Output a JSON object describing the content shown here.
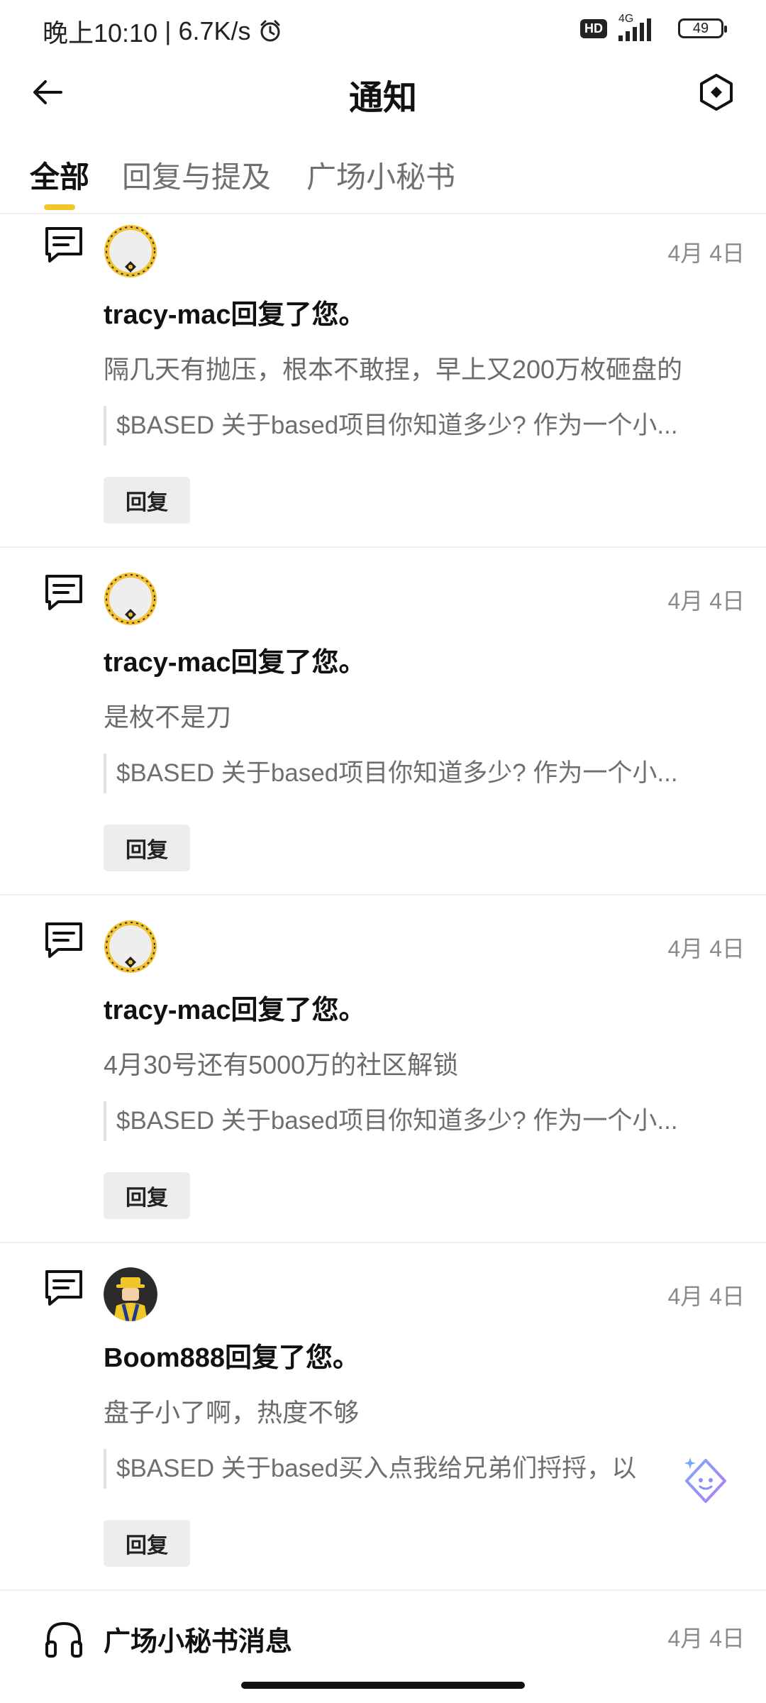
{
  "status": {
    "time": "晚上10:10",
    "speed": "6.7K/s",
    "hd": "HD",
    "network": "4G",
    "battery": "49"
  },
  "header": {
    "title": "通知"
  },
  "tabs": [
    {
      "label": "全部",
      "active": true
    },
    {
      "label": "回复与提及",
      "active": false
    },
    {
      "label": "广场小秘书",
      "active": false
    }
  ],
  "notifications": [
    {
      "date": "4月 4日",
      "title": "tracy-mac回复了您。",
      "body": "隔几天有抛压，根本不敢捏，早上又200万枚砸盘的",
      "quote": "$BASED 关于based项目你知道多少? 作为一个小...",
      "reply_label": "回复"
    },
    {
      "date": "4月 4日",
      "title": "tracy-mac回复了您。",
      "body": "是枚不是刀",
      "quote": "$BASED 关于based项目你知道多少? 作为一个小...",
      "reply_label": "回复"
    },
    {
      "date": "4月 4日",
      "title": "tracy-mac回复了您。",
      "body": "4月30号还有5000万的社区解锁",
      "quote": "$BASED 关于based项目你知道多少? 作为一个小...",
      "reply_label": "回复"
    },
    {
      "date": "4月 4日",
      "title": "Boom888回复了您。",
      "body": "盘子小了啊，热度不够",
      "quote": "$BASED 关于based买入点我给兄弟们捋捋，以",
      "reply_label": "回复"
    }
  ],
  "secretary": {
    "label": "广场小秘书消息",
    "date": "4月 4日"
  },
  "colors": {
    "accent": "#f0c62a",
    "muted_text": "#6b6b6b",
    "date_text": "#8a8a8a"
  }
}
